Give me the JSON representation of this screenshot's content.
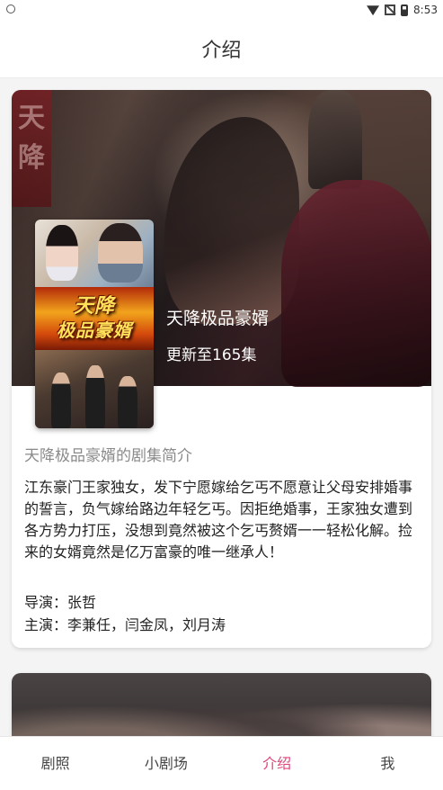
{
  "status_bar": {
    "time": "8:53",
    "icons": [
      "app-notification-icon",
      "wifi-icon",
      "no-sim-icon",
      "battery-icon"
    ]
  },
  "header": {
    "title": "介绍"
  },
  "colors": {
    "accent": "#e0437a",
    "text_primary": "#222222",
    "text_secondary": "#8a8a8a"
  },
  "drama": {
    "banner_text": "天降",
    "poster_title_line1": "天降",
    "poster_title_line2": "极品豪婿",
    "title": "天降极品豪婿",
    "episodes": "更新至165集",
    "synopsis_heading": "天降极品豪婿的剧集简介",
    "synopsis": "江东豪门王家独女，发下宁愿嫁给乞丐不愿意让父母安排婚事的誓言，负气嫁给路边年轻乞丐。因拒绝婚事，王家独女遭到各方势力打压，没想到竟然被这个乞丐赘婿一一轻松化解。捡来的女婿竟然是亿万富豪的唯一继承人！",
    "director": "导演：张哲",
    "cast": "主演：李兼任，闫金凤，刘月涛"
  },
  "tabs": [
    {
      "label": "剧照",
      "active": false
    },
    {
      "label": "小剧场",
      "active": false
    },
    {
      "label": "介绍",
      "active": true
    },
    {
      "label": "我",
      "active": false
    }
  ]
}
